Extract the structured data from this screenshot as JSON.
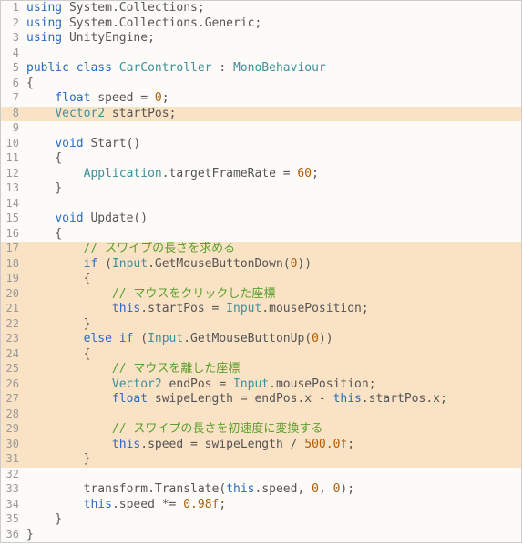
{
  "language": "csharp",
  "lines": [
    {
      "n": 1,
      "hl": false,
      "tokens": [
        [
          "kw",
          "using"
        ],
        [
          "ident",
          " System"
        ],
        [
          "punct",
          "."
        ],
        [
          "ident",
          "Collections"
        ],
        [
          "punct",
          ";"
        ]
      ]
    },
    {
      "n": 2,
      "hl": false,
      "tokens": [
        [
          "kw",
          "using"
        ],
        [
          "ident",
          " System"
        ],
        [
          "punct",
          "."
        ],
        [
          "ident",
          "Collections"
        ],
        [
          "punct",
          "."
        ],
        [
          "ident",
          "Generic"
        ],
        [
          "punct",
          ";"
        ]
      ]
    },
    {
      "n": 3,
      "hl": false,
      "tokens": [
        [
          "kw",
          "using"
        ],
        [
          "ident",
          " UnityEngine"
        ],
        [
          "punct",
          ";"
        ]
      ]
    },
    {
      "n": 4,
      "hl": false,
      "tokens": []
    },
    {
      "n": 5,
      "hl": false,
      "tokens": [
        [
          "kw",
          "public"
        ],
        [
          "kw",
          " class"
        ],
        [
          "cls",
          " CarController"
        ],
        [
          "punct",
          " : "
        ],
        [
          "cls",
          "MonoBehaviour"
        ]
      ]
    },
    {
      "n": 6,
      "hl": false,
      "tokens": [
        [
          "punct",
          "{"
        ]
      ]
    },
    {
      "n": 7,
      "hl": false,
      "tokens": [
        [
          "ident",
          "    "
        ],
        [
          "kw",
          "float"
        ],
        [
          "ident",
          " speed "
        ],
        [
          "punct",
          "="
        ],
        [
          "num",
          " 0"
        ],
        [
          "punct",
          ";"
        ]
      ]
    },
    {
      "n": 8,
      "hl": true,
      "tokens": [
        [
          "ident",
          "    "
        ],
        [
          "type",
          "Vector2"
        ],
        [
          "ident",
          " startPos"
        ],
        [
          "punct",
          ";"
        ]
      ]
    },
    {
      "n": 9,
      "hl": false,
      "tokens": []
    },
    {
      "n": 10,
      "hl": false,
      "tokens": [
        [
          "ident",
          "    "
        ],
        [
          "kw",
          "void"
        ],
        [
          "ident",
          " Start"
        ],
        [
          "punct",
          "()"
        ]
      ]
    },
    {
      "n": 11,
      "hl": false,
      "tokens": [
        [
          "punct",
          "    {"
        ]
      ]
    },
    {
      "n": 12,
      "hl": false,
      "tokens": [
        [
          "ident",
          "        "
        ],
        [
          "type",
          "Application"
        ],
        [
          "punct",
          "."
        ],
        [
          "ident",
          "targetFrameRate "
        ],
        [
          "punct",
          "="
        ],
        [
          "num",
          " 60"
        ],
        [
          "punct",
          ";"
        ]
      ]
    },
    {
      "n": 13,
      "hl": false,
      "tokens": [
        [
          "punct",
          "    }"
        ]
      ]
    },
    {
      "n": 14,
      "hl": false,
      "tokens": []
    },
    {
      "n": 15,
      "hl": false,
      "tokens": [
        [
          "ident",
          "    "
        ],
        [
          "kw",
          "void"
        ],
        [
          "ident",
          " Update"
        ],
        [
          "punct",
          "()"
        ]
      ]
    },
    {
      "n": 16,
      "hl": false,
      "tokens": [
        [
          "punct",
          "    {"
        ]
      ]
    },
    {
      "n": 17,
      "hl": true,
      "tokens": [
        [
          "ident",
          "        "
        ],
        [
          "comment",
          "// スワイプの長さを求める"
        ]
      ]
    },
    {
      "n": 18,
      "hl": true,
      "tokens": [
        [
          "ident",
          "        "
        ],
        [
          "kw",
          "if"
        ],
        [
          "punct",
          " ("
        ],
        [
          "type",
          "Input"
        ],
        [
          "punct",
          "."
        ],
        [
          "ident",
          "GetMouseButtonDown"
        ],
        [
          "punct",
          "("
        ],
        [
          "num",
          "0"
        ],
        [
          "punct",
          "))"
        ]
      ]
    },
    {
      "n": 19,
      "hl": true,
      "tokens": [
        [
          "punct",
          "        {"
        ]
      ]
    },
    {
      "n": 20,
      "hl": true,
      "tokens": [
        [
          "ident",
          "            "
        ],
        [
          "comment",
          "// マウスをクリックした座標"
        ]
      ]
    },
    {
      "n": 21,
      "hl": true,
      "tokens": [
        [
          "ident",
          "            "
        ],
        [
          "kw",
          "this"
        ],
        [
          "punct",
          "."
        ],
        [
          "ident",
          "startPos "
        ],
        [
          "punct",
          "="
        ],
        [
          "ident",
          " "
        ],
        [
          "type",
          "Input"
        ],
        [
          "punct",
          "."
        ],
        [
          "ident",
          "mousePosition"
        ],
        [
          "punct",
          ";"
        ]
      ]
    },
    {
      "n": 22,
      "hl": true,
      "tokens": [
        [
          "punct",
          "        }"
        ]
      ]
    },
    {
      "n": 23,
      "hl": true,
      "tokens": [
        [
          "ident",
          "        "
        ],
        [
          "kw",
          "else"
        ],
        [
          "kw",
          " if"
        ],
        [
          "punct",
          " ("
        ],
        [
          "type",
          "Input"
        ],
        [
          "punct",
          "."
        ],
        [
          "ident",
          "GetMouseButtonUp"
        ],
        [
          "punct",
          "("
        ],
        [
          "num",
          "0"
        ],
        [
          "punct",
          "))"
        ]
      ]
    },
    {
      "n": 24,
      "hl": true,
      "tokens": [
        [
          "punct",
          "        {"
        ]
      ]
    },
    {
      "n": 25,
      "hl": true,
      "tokens": [
        [
          "ident",
          "            "
        ],
        [
          "comment",
          "// マウスを離した座標"
        ]
      ]
    },
    {
      "n": 26,
      "hl": true,
      "tokens": [
        [
          "ident",
          "            "
        ],
        [
          "type",
          "Vector2"
        ],
        [
          "ident",
          " endPos "
        ],
        [
          "punct",
          "="
        ],
        [
          "ident",
          " "
        ],
        [
          "type",
          "Input"
        ],
        [
          "punct",
          "."
        ],
        [
          "ident",
          "mousePosition"
        ],
        [
          "punct",
          ";"
        ]
      ]
    },
    {
      "n": 27,
      "hl": true,
      "tokens": [
        [
          "ident",
          "            "
        ],
        [
          "kw",
          "float"
        ],
        [
          "ident",
          " swipeLength "
        ],
        [
          "punct",
          "="
        ],
        [
          "ident",
          " endPos"
        ],
        [
          "punct",
          "."
        ],
        [
          "ident",
          "x "
        ],
        [
          "punct",
          "-"
        ],
        [
          "ident",
          " "
        ],
        [
          "kw",
          "this"
        ],
        [
          "punct",
          "."
        ],
        [
          "ident",
          "startPos"
        ],
        [
          "punct",
          "."
        ],
        [
          "ident",
          "x"
        ],
        [
          "punct",
          ";"
        ]
      ]
    },
    {
      "n": 28,
      "hl": true,
      "tokens": []
    },
    {
      "n": 29,
      "hl": true,
      "tokens": [
        [
          "ident",
          "            "
        ],
        [
          "comment",
          "// スワイプの長さを初速度に変換する"
        ]
      ]
    },
    {
      "n": 30,
      "hl": true,
      "tokens": [
        [
          "ident",
          "            "
        ],
        [
          "kw",
          "this"
        ],
        [
          "punct",
          "."
        ],
        [
          "ident",
          "speed "
        ],
        [
          "punct",
          "="
        ],
        [
          "ident",
          " swipeLength "
        ],
        [
          "punct",
          "/"
        ],
        [
          "num",
          " 500.0f"
        ],
        [
          "punct",
          ";"
        ]
      ]
    },
    {
      "n": 31,
      "hl": true,
      "tokens": [
        [
          "punct",
          "        }"
        ]
      ]
    },
    {
      "n": 32,
      "hl": false,
      "tokens": []
    },
    {
      "n": 33,
      "hl": false,
      "tokens": [
        [
          "ident",
          "        transform"
        ],
        [
          "punct",
          "."
        ],
        [
          "ident",
          "Translate"
        ],
        [
          "punct",
          "("
        ],
        [
          "kw",
          "this"
        ],
        [
          "punct",
          "."
        ],
        [
          "ident",
          "speed"
        ],
        [
          "punct",
          ","
        ],
        [
          "num",
          " 0"
        ],
        [
          "punct",
          ","
        ],
        [
          "num",
          " 0"
        ],
        [
          "punct",
          ");"
        ]
      ]
    },
    {
      "n": 34,
      "hl": false,
      "tokens": [
        [
          "ident",
          "        "
        ],
        [
          "kw",
          "this"
        ],
        [
          "punct",
          "."
        ],
        [
          "ident",
          "speed "
        ],
        [
          "punct",
          "*="
        ],
        [
          "num",
          " 0.98f"
        ],
        [
          "punct",
          ";"
        ]
      ]
    },
    {
      "n": 35,
      "hl": false,
      "tokens": [
        [
          "punct",
          "    }"
        ]
      ]
    },
    {
      "n": 36,
      "hl": false,
      "tokens": [
        [
          "punct",
          "}"
        ]
      ]
    }
  ]
}
